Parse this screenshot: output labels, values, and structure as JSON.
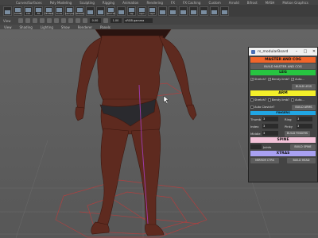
{
  "menubar": {
    "items": [
      "Curves/Surfaces",
      "Poly Modeling",
      "Sculpting",
      "Rigging",
      "Animation",
      "Rendering",
      "FX",
      "FX Caching",
      "Custom",
      "Arnold",
      "Bifrost",
      "MASH",
      "Motion Graphics"
    ]
  },
  "shelf": {
    "buttons": [
      "",
      "CCMB",
      "DR",
      "FR",
      "TEXNAME",
      "tools",
      "sample",
      "SPONG",
      "",
      "",
      "SPCTW",
      "",
      "rep",
      "rep1",
      "rep2",
      "",
      "",
      "",
      "",
      "",
      "",
      ""
    ]
  },
  "topbar": {
    "view_label": "View",
    "field_a": "0.00",
    "field_b": "1.00",
    "camera": "sRGB gamma"
  },
  "viewport_menu": {
    "items": [
      "View",
      "Shading",
      "Lighting",
      "Show",
      "Renderer",
      "Panels"
    ]
  },
  "panel": {
    "title": "rs_modularBoard",
    "master": {
      "header": "MASTER AND COG",
      "header_color": "#f2652a",
      "button": "BUILD MASTER AND COG"
    },
    "leg": {
      "header": "LEG",
      "header_color": "#27c541",
      "stretch": "Stretch?",
      "bendy": "Bendy limb?",
      "auto": "Auto...",
      "button": "BUILD LEGS"
    },
    "arm": {
      "header": "ARM",
      "header_color": "#f3ef2a",
      "stretch": "Stretch?",
      "bendy": "Bendy limb?",
      "auto": "Auto...",
      "autoclav": "Auto Clavicle?",
      "button": "BUILD ARMS"
    },
    "fingers": {
      "header": "FINGERS",
      "header_color": "#21a6e4",
      "thumb": "Thumb",
      "ring": "Ring",
      "index": "Index",
      "pinky": "Pinky",
      "middle": "Middle",
      "val_thumb": "3",
      "val_ring": "3",
      "val_index": "3",
      "val_pinky": "3",
      "val_middle": "3",
      "button": "BUILD FINGERS"
    },
    "spine": {
      "header": "SPINE",
      "header_color": "#f3c2d8",
      "field": "Joints",
      "value": "",
      "button": "BUILD SPINE"
    },
    "xtras": {
      "header": "XTRAS",
      "header_color": "#a9a1f2",
      "mirror": "MIRROR CTRS",
      "head": "BUILD HEAD"
    }
  }
}
